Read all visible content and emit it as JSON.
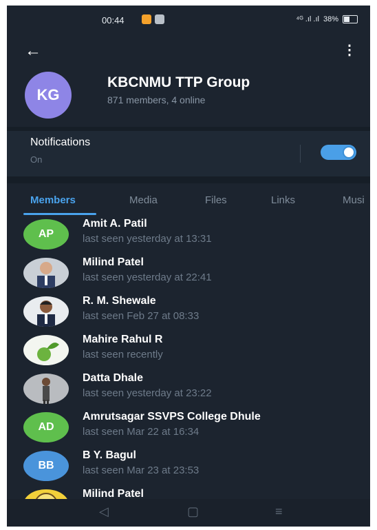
{
  "status": {
    "time": "00:44",
    "signal": "⁴ᴳ .ıl .ıl",
    "battery": "38%",
    "battery_level": 0.38
  },
  "appbar": {
    "back_icon": "arrow-left-icon",
    "more_icon": "more-vert-icon"
  },
  "group": {
    "initials": "KG",
    "avatar_color": "#8e85e6",
    "title": "KBCNMU TTP Group",
    "subtitle": "871 members, 4 online"
  },
  "notifications": {
    "label": "Notifications",
    "value": "On",
    "enabled": true
  },
  "tabs": [
    {
      "label": "Members",
      "active": true
    },
    {
      "label": "Media"
    },
    {
      "label": "Files"
    },
    {
      "label": "Links"
    },
    {
      "label": "Musi"
    }
  ],
  "members": [
    {
      "name": "Amit A. Patil",
      "seen": "last seen yesterday at 13:31",
      "initials": "AP",
      "color": "#5fbf4d"
    },
    {
      "name": "Milind Patel",
      "seen": "last seen yesterday at 22:41",
      "photo": "portrait"
    },
    {
      "name": "R. M. Shewale",
      "seen": "last seen Feb 27 at 08:33",
      "photo": "portrait"
    },
    {
      "name": "Mahire Rahul R",
      "seen": "last seen recently",
      "photo": "plant"
    },
    {
      "name": "Datta Dhale",
      "seen": "last seen yesterday at 23:22",
      "photo": "portrait"
    },
    {
      "name": "Amrutsagar SSVPS College Dhule",
      "seen": "last seen Mar 22 at 16:34",
      "initials": "AD",
      "color": "#5fbf4d"
    },
    {
      "name": "B Y. Bagul",
      "seen": "last seen Mar 23 at 23:53",
      "initials": "BB",
      "color": "#4a94db"
    },
    {
      "name": "Milind Patel",
      "seen": "",
      "photo": "logo"
    }
  ],
  "navbar": {
    "back_icon": "nav-back-icon",
    "home_icon": "nav-home-icon",
    "menu_icon": "nav-menu-icon"
  }
}
